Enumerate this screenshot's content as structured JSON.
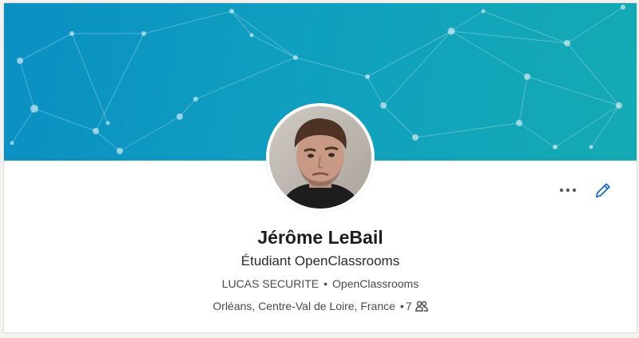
{
  "profile": {
    "name": "Jérôme LeBail",
    "headline": "Étudiant OpenClassrooms",
    "company": "LUCAS SECURITE",
    "school": "OpenClassrooms",
    "location": "Orléans, Centre-Val de Loire, France",
    "separator": "•",
    "connections_count": "7"
  },
  "icons": {
    "more": "more-horizontal-icon",
    "edit": "pencil-icon",
    "connections": "people-icon"
  },
  "colors": {
    "accent": "#0a66c2",
    "banner_start": "#0a8fc2",
    "banner_end": "#15aab3"
  }
}
